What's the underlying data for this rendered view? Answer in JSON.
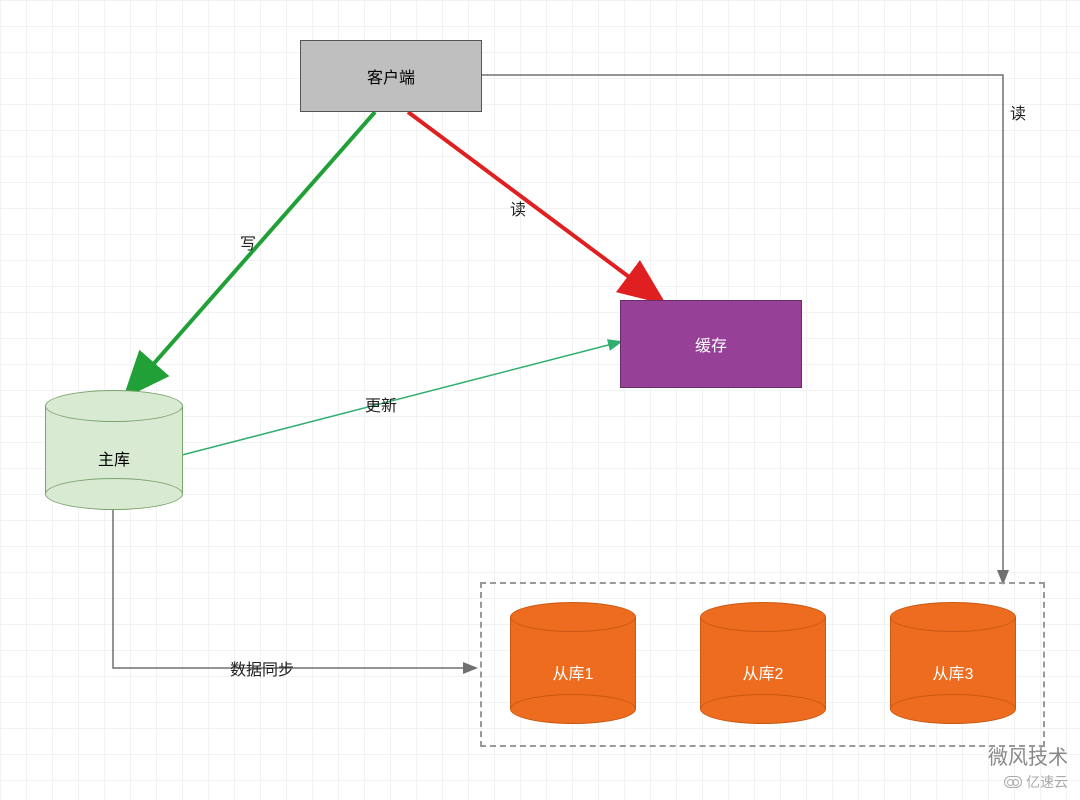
{
  "nodes": {
    "client": {
      "label": "客户端"
    },
    "cache": {
      "label": "缓存"
    },
    "master": {
      "label": "主库"
    },
    "replica1": {
      "label": "从库1"
    },
    "replica2": {
      "label": "从库2"
    },
    "replica3": {
      "label": "从库3"
    }
  },
  "edges": {
    "write": {
      "label": "写"
    },
    "readCache": {
      "label": "读"
    },
    "readDb": {
      "label": "读"
    },
    "update": {
      "label": "更新"
    },
    "sync": {
      "label": "数据同步"
    }
  },
  "colors": {
    "grid": "#f2f2f2",
    "client_fill": "#bfbfbf",
    "cache_fill": "#974097",
    "master_fill": "#d9ead3",
    "replica_fill": "#ed6c1f",
    "arrow_green": "#21a038",
    "arrow_red": "#e02020",
    "arrow_gray": "#707070",
    "arrow_teal": "#2fae6f"
  },
  "watermark": {
    "line1": "微风技术",
    "line2": "亿速云"
  }
}
